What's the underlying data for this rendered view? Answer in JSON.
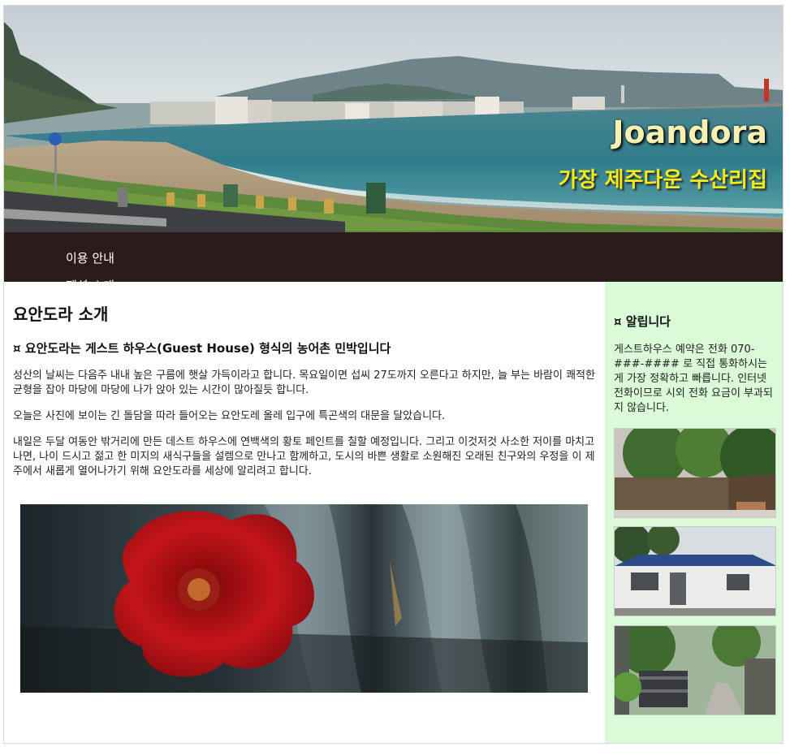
{
  "header": {
    "site_title": "Joandora",
    "tagline": "가장 제주다운 수산리집"
  },
  "nav": {
    "items": [
      {
        "label": "이용 안내"
      },
      {
        "label": "펜션 소개"
      }
    ]
  },
  "main": {
    "title": "요안도라 소개",
    "subtitle": "¤ 요안도라는 게스트 하우스(Guest House) 형식의 농어촌 민박입니다",
    "paragraphs": [
      "성산의 날씨는 다음주 내내 높은 구름에 햇살 가득이라고 합니다. 목요일이면 섭씨 27도까지 오른다고 하지만, 늘 부는 바람이 쾌적한 균형을 잡아 마당에 마당에 나가 앉아 있는 시간이 많아질듯 합니다.",
      "오늘은 사진에 보이는 긴 돌담을 따라 들어오는 요안도레 올레 입구에 특곤색의 대문을 달았습니다.",
      "내일은 두달 여동안 밖거리에 만든 데스트 하우스에 연백색의 황토 페인트를 칠할 예정입니다. 그리고 이것저것 사소한 저이를 마치고 나면, 나이 드시고 젊고 한 미지의 새식구들을 설렘으로 만나고 함께하고, 도시의 바쁜 생활로 소원해진 오래된 친구와의 우정을 이 제주에서 새롭게 열어나가기 위해 요안도라를 세상에 알리려고 합니다."
    ]
  },
  "sidebar": {
    "notice_title": "¤ 알립니다",
    "notice_text": "게스트하우스 예약은 전화 070-###-#### 로 직접 통화하시는 게 가장 정확하고 빠릅니다. 인터넷 전화이므로 시외 전화 요금이 부과되지 않습니다."
  },
  "colors": {
    "nav_bg": "#2b1b1b",
    "sidebar_bg": "#d9fbd8",
    "title_color": "#f6f0b2",
    "tagline_color": "#f3ea1c"
  }
}
